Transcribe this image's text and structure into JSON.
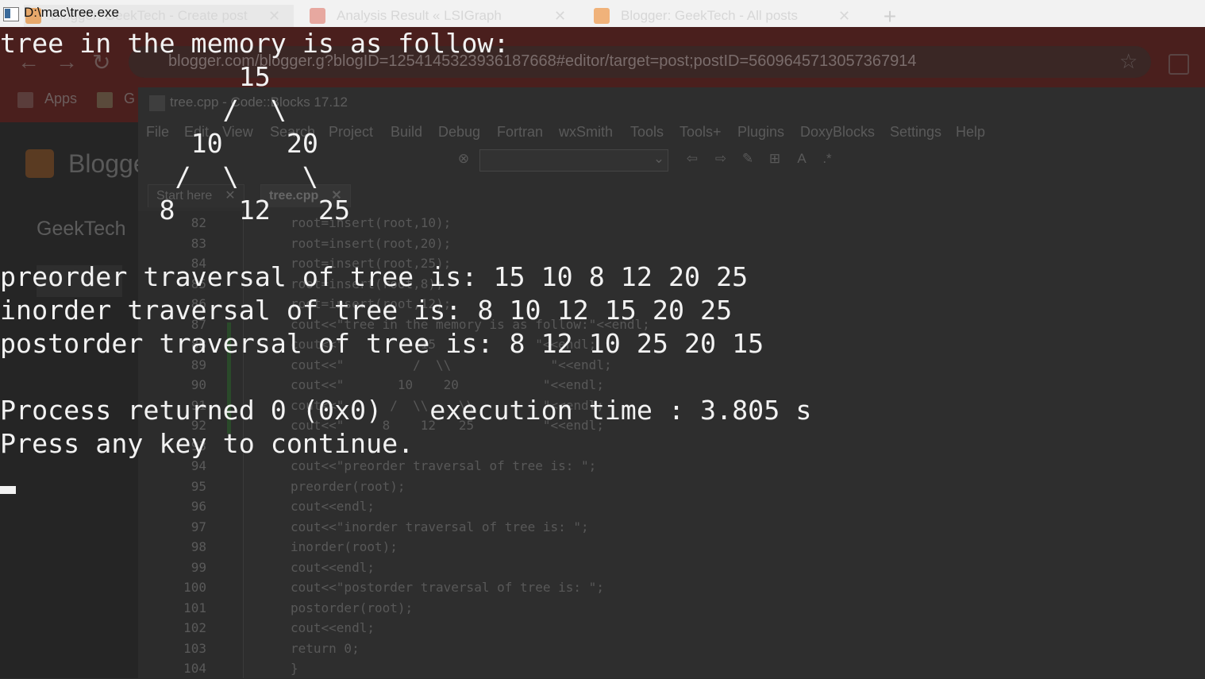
{
  "chrome": {
    "tabs": [
      {
        "title": "Blogger: GeekTech - Create post",
        "close": "✕"
      },
      {
        "title": "Analysis Result « LSIGraph",
        "close": "✕"
      },
      {
        "title": "Blogger: GeekTech - All posts",
        "close": "✕"
      }
    ],
    "new_tab": "+",
    "url": "blogger.com/blogger.g?blogID=1254145323936187668#editor/target=post;postID=5609645713057367914",
    "bookmarks": [
      "Apps",
      "G"
    ]
  },
  "blogger": {
    "brand": "Blogger",
    "site": "GeekTech"
  },
  "codeblocks": {
    "title": "tree.cpp - Code::Blocks 17.12",
    "menu": [
      "File",
      "Edit",
      "View",
      "Search",
      "Project",
      "Build",
      "Debug",
      "Fortran",
      "wxSmith",
      "Tools",
      "Tools+",
      "Plugins",
      "DoxyBlocks",
      "Settings",
      "Help"
    ],
    "tabs": [
      {
        "label": "Start here",
        "close": "✕"
      },
      {
        "label": "tree.cpp",
        "close": "✕"
      }
    ],
    "line_numbers": [
      "82",
      "83",
      "84",
      "85",
      "86",
      "87",
      "88",
      "89",
      "90",
      "91",
      "92",
      "93",
      "94",
      "95",
      "96",
      "97",
      "98",
      "99",
      "100",
      "101",
      "102",
      "103",
      "104"
    ],
    "code_lines": [
      "root=insert(root,10);",
      "root=insert(root,20);",
      "root=insert(root,25);",
      "root=insert(root,8);",
      "root=insert(root,12);",
      "cout<<\"tree in the memory is as follow:\"<<endl;",
      "cout<<\"          15             \"<<endl;",
      "cout<<\"         /  \\\\             \"<<endl;",
      "cout<<\"       10    20           \"<<endl;",
      "cout<<\"      /  \\\\    \\\\         \"<<endl;",
      "cout<<\"     8    12   25         \"<<endl;",
      "",
      "cout<<\"preorder traversal of tree is: \";",
      "preorder(root);",
      "cout<<endl;",
      "cout<<\"inorder traversal of tree is: \";",
      "inorder(root);",
      "cout<<endl;",
      "cout<<\"postorder traversal of tree is: \";",
      "postorder(root);",
      "cout<<endl;",
      "return 0;",
      "}"
    ]
  },
  "console": {
    "title": "D:\\mac\\tree.exe",
    "lines": [
      "tree in the memory is as follow:",
      "               15",
      "              /  \\",
      "            10    20",
      "           /  \\    \\",
      "          8    12   25",
      "",
      "preorder traversal of tree is: 15 10 8 12 20 25",
      "inorder traversal of tree is: 8 10 12 15 20 25",
      "postorder traversal of tree is: 8 12 10 25 20 15",
      "",
      "Process returned 0 (0x0)   execution time : 3.805 s",
      "Press any key to continue."
    ]
  }
}
